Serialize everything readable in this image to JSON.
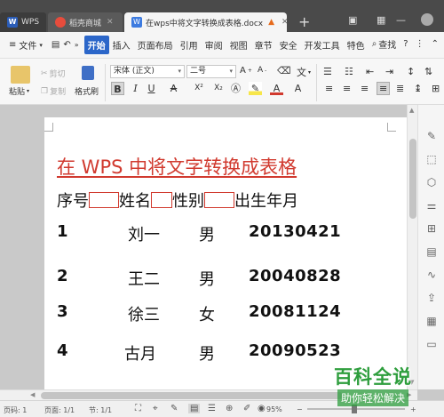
{
  "tabs": [
    {
      "label": "WPS"
    },
    {
      "label": "稻壳商城"
    },
    {
      "label": "在wps中将文字转换成表格.docx"
    }
  ],
  "menu": {
    "file": "文件",
    "items": [
      "开始",
      "插入",
      "页面布局",
      "引用",
      "审阅",
      "视图",
      "章节",
      "安全",
      "开发工具",
      "特色"
    ],
    "search": "查找",
    "help": "?"
  },
  "ribbon": {
    "paste": "粘贴",
    "cut": "剪切",
    "copy": "复制",
    "format_painter": "格式刷",
    "font_name": "宋体 (正文)",
    "font_size": "二号",
    "bold": "B",
    "italic": "I",
    "underline": "U",
    "strike": "A",
    "superscript": "X²",
    "subscript": "X₂"
  },
  "document": {
    "title": "在 WPS 中将文字转换成表格",
    "headers": [
      "序号",
      "姓名",
      "性别",
      "出生年月"
    ],
    "rows": [
      {
        "num": "1",
        "name": "刘一",
        "gender": "男",
        "date": "20130421"
      },
      {
        "num": "2",
        "name": "王二",
        "gender": "男",
        "date": "20040828"
      },
      {
        "num": "3",
        "name": "徐三",
        "gender": "女",
        "date": "20081124"
      },
      {
        "num": "4",
        "name": "古月",
        "gender": "男",
        "date": "20090523"
      }
    ]
  },
  "status": {
    "page_count": "页码: 1",
    "page": "页面: 1/1",
    "section": "节: 1/1",
    "zoom": "95%"
  },
  "watermark": {
    "main": "百科全说",
    "sub": "助你轻松解决"
  },
  "colors": {
    "title_red": "#d13a2f",
    "accent_blue": "#2b66c9",
    "watermark_green": "#2e9e3d"
  }
}
